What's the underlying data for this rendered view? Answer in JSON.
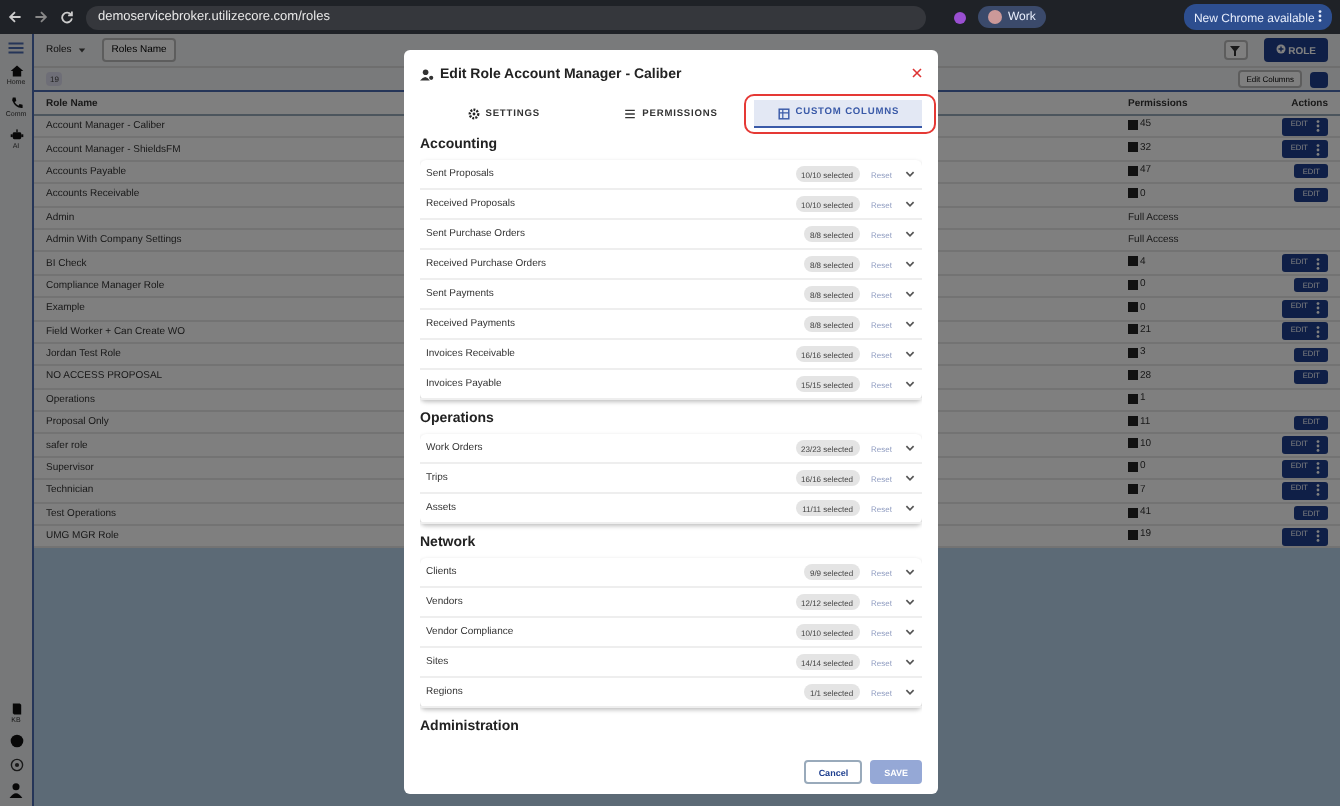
{
  "browser": {
    "url": "demoservicebroker.utilizecore.com/roles",
    "profile": "Work",
    "update_button": "New Chrome available"
  },
  "sidebar": {
    "top_items": [
      {
        "label": "Home",
        "kind": "home"
      },
      {
        "label": "Comm",
        "kind": "phone"
      },
      {
        "label": "AI",
        "kind": "robot"
      }
    ],
    "bottom_items": [
      {
        "label": "KB",
        "kind": "book"
      }
    ]
  },
  "toolbar": {
    "view_select": "Roles",
    "filter_chip": "Roles Name",
    "add_button": "ROLE",
    "count": "19",
    "edit_columns": "Edit Columns"
  },
  "table": {
    "columns": [
      "Role Name",
      "Permissions",
      "Actions"
    ],
    "rows": [
      {
        "name": "Account Manager - Caliber",
        "permission": {
          "kind": "count",
          "text": "45"
        },
        "action": {
          "kind": "split",
          "label": "EDIT"
        }
      },
      {
        "name": "Account Manager - ShieldsFM",
        "permission": {
          "kind": "count",
          "text": "32"
        },
        "action": {
          "kind": "split",
          "label": "EDIT"
        }
      },
      {
        "name": "Accounts Payable",
        "permission": {
          "kind": "count",
          "text": "47"
        },
        "action": {
          "kind": "single",
          "label": "EDIT"
        }
      },
      {
        "name": "Accounts Receivable",
        "permission": {
          "kind": "count",
          "text": "0"
        },
        "action": {
          "kind": "single",
          "label": "EDIT"
        }
      },
      {
        "name": "Admin",
        "permission": {
          "kind": "full",
          "text": "Full Access"
        }
      },
      {
        "name": "Admin With Company Settings",
        "permission": {
          "kind": "full",
          "text": "Full Access"
        }
      },
      {
        "name": "BI Check",
        "permission": {
          "kind": "count",
          "text": "4"
        },
        "action": {
          "kind": "split",
          "label": "EDIT"
        }
      },
      {
        "name": "Compliance Manager Role",
        "permission": {
          "kind": "count",
          "text": "0"
        },
        "action": {
          "kind": "single",
          "label": "EDIT"
        }
      },
      {
        "name": "Example",
        "permission": {
          "kind": "count",
          "text": "0"
        },
        "action": {
          "kind": "split",
          "label": "EDIT"
        }
      },
      {
        "name": "Field Worker + Can Create WO",
        "permission": {
          "kind": "count",
          "text": "21"
        },
        "action": {
          "kind": "split",
          "label": "EDIT"
        }
      },
      {
        "name": "Jordan Test Role",
        "permission": {
          "kind": "count",
          "text": "3"
        },
        "action": {
          "kind": "single",
          "label": "EDIT"
        }
      },
      {
        "name": "NO ACCESS PROPOSAL",
        "permission": {
          "kind": "count",
          "text": "28"
        },
        "action": {
          "kind": "single",
          "label": "EDIT"
        }
      },
      {
        "name": "Operations",
        "permission": {
          "kind": "count",
          "text": "1"
        }
      },
      {
        "name": "Proposal Only",
        "permission": {
          "kind": "count",
          "text": "11"
        },
        "action": {
          "kind": "single",
          "label": "EDIT"
        }
      },
      {
        "name": "safer role",
        "permission": {
          "kind": "count",
          "text": "10"
        },
        "action": {
          "kind": "split",
          "label": "EDIT"
        }
      },
      {
        "name": "Supervisor",
        "permission": {
          "kind": "count",
          "text": "0"
        },
        "action": {
          "kind": "split",
          "label": "EDIT"
        }
      },
      {
        "name": "Technician",
        "permission": {
          "kind": "count",
          "text": "7"
        },
        "action": {
          "kind": "split",
          "label": "EDIT"
        }
      },
      {
        "name": "Test Operations",
        "permission": {
          "kind": "count",
          "text": "41"
        },
        "action": {
          "kind": "single",
          "label": "EDIT"
        }
      },
      {
        "name": "UMG MGR Role",
        "permission": {
          "kind": "count",
          "text": "19"
        },
        "action": {
          "kind": "split",
          "label": "EDIT"
        }
      }
    ]
  },
  "modal": {
    "title": "Edit Role Account Manager - Caliber",
    "tabs": [
      {
        "label": "SETTINGS",
        "kind": "gear",
        "selected": false,
        "highlighted": false
      },
      {
        "label": "PERMISSIONS",
        "kind": "list",
        "selected": false,
        "highlighted": false
      },
      {
        "label": "CUSTOM COLUMNS",
        "kind": "columns",
        "selected": true,
        "highlighted": true
      }
    ],
    "sections": [
      {
        "title": "Accounting",
        "items": [
          {
            "name": "Sent Proposals",
            "badge": "10/10 selected",
            "reset": "Reset",
            "reset_disabled": true
          },
          {
            "name": "Received Proposals",
            "badge": "10/10 selected",
            "reset": "Reset",
            "reset_disabled": true
          },
          {
            "name": "Sent Purchase Orders",
            "badge": "8/8 selected",
            "reset": "Reset",
            "reset_disabled": true
          },
          {
            "name": "Received Purchase Orders",
            "badge": "8/8 selected",
            "reset": "Reset",
            "reset_disabled": true
          },
          {
            "name": "Sent Payments",
            "badge": "8/8 selected",
            "reset": "Reset",
            "reset_disabled": true
          },
          {
            "name": "Received Payments",
            "badge": "8/8 selected",
            "reset": "Reset",
            "reset_disabled": true
          },
          {
            "name": "Invoices Receivable",
            "badge": "16/16 selected",
            "reset": "Reset",
            "reset_disabled": true
          },
          {
            "name": "Invoices Payable",
            "badge": "15/15 selected",
            "reset": "Reset",
            "reset_disabled": true
          }
        ]
      },
      {
        "title": "Operations",
        "items": [
          {
            "name": "Work Orders",
            "badge": "23/23 selected",
            "reset": "Reset",
            "reset_disabled": true
          },
          {
            "name": "Trips",
            "badge": "16/16 selected",
            "reset": "Reset",
            "reset_disabled": true
          },
          {
            "name": "Assets",
            "badge": "11/11 selected",
            "reset": "Reset",
            "reset_disabled": true
          }
        ]
      },
      {
        "title": "Network",
        "items": [
          {
            "name": "Clients",
            "badge": "9/9 selected",
            "reset": "Reset",
            "reset_disabled": true
          },
          {
            "name": "Vendors",
            "badge": "12/12 selected",
            "reset": "Reset",
            "reset_disabled": true
          },
          {
            "name": "Vendor Compliance",
            "badge": "10/10 selected",
            "reset": "Reset",
            "reset_disabled": true
          },
          {
            "name": "Sites",
            "badge": "14/14 selected",
            "reset": "Reset",
            "reset_disabled": true
          },
          {
            "name": "Regions",
            "badge": "1/1 selected",
            "reset": "Reset",
            "reset_disabled": true
          }
        ]
      },
      {
        "title": "Administration"
      }
    ],
    "buttons": [
      {
        "label": "Cancel",
        "kind": "secondary",
        "disabled": false
      },
      {
        "label": "SAVE",
        "kind": "primary",
        "disabled": true
      }
    ]
  }
}
